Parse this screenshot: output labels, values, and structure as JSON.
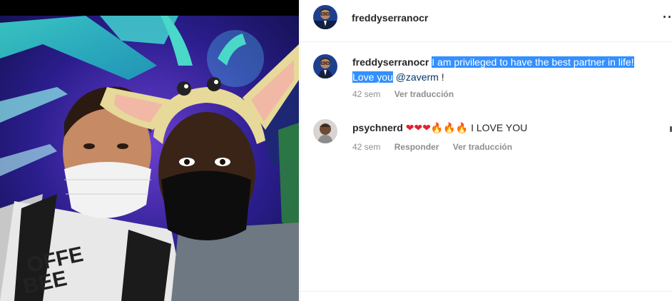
{
  "post": {
    "author": "freddyserranocr",
    "more_icon": "more-horizontal-icon"
  },
  "caption": {
    "username": "freddyserranocr",
    "text_highlighted_1": "I am privileged to have the best partner in life!",
    "text_highlighted_2": "Love you",
    "mention": "@zaverm",
    "tail": " !",
    "time": "42 sem",
    "translate": "Ver traducción"
  },
  "comments": [
    {
      "username": "psychnerd",
      "hearts": "❤❤❤",
      "fires": "🔥🔥🔥",
      "text": "I LOVE YOU",
      "time": "42 sem",
      "reply": "Responder",
      "translate": "Ver traducción"
    }
  ],
  "colors": {
    "highlight": "#3390ff",
    "mention": "#00376b",
    "meta": "#8e8e8e"
  }
}
